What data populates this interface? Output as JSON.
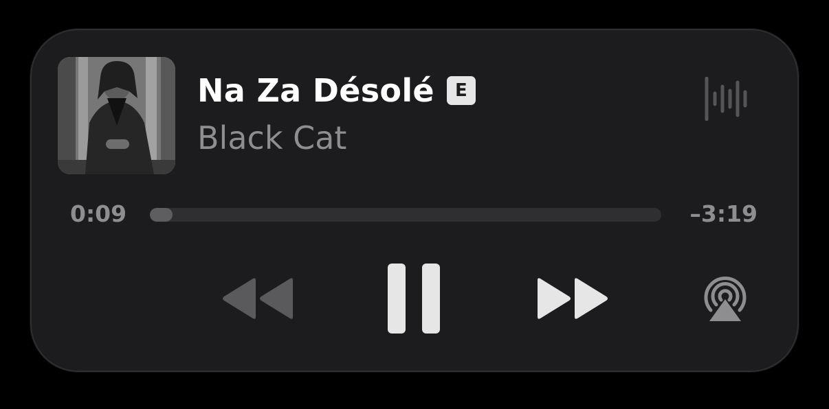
{
  "now_playing": {
    "title": "Na Za Désolé",
    "explicit_badge": "E",
    "artist": "Black Cat"
  },
  "progress": {
    "elapsed": "0:09",
    "remaining": "–3:19",
    "fraction": 0.045
  },
  "icons": {
    "artwork": "album-artwork",
    "waveform": "waveform-icon",
    "rewind": "rewind-icon",
    "pause": "pause-icon",
    "forward": "fast-forward-icon",
    "airplay": "airplay-icon"
  },
  "colors": {
    "card_background": "#1c1c1e",
    "title": "#ffffff",
    "secondary_text": "#8e8e90",
    "track": "#2f2f31",
    "fill": "#5e5e60",
    "control_active": "#e6e6e6",
    "control_disabled": "#5a5a5c"
  }
}
